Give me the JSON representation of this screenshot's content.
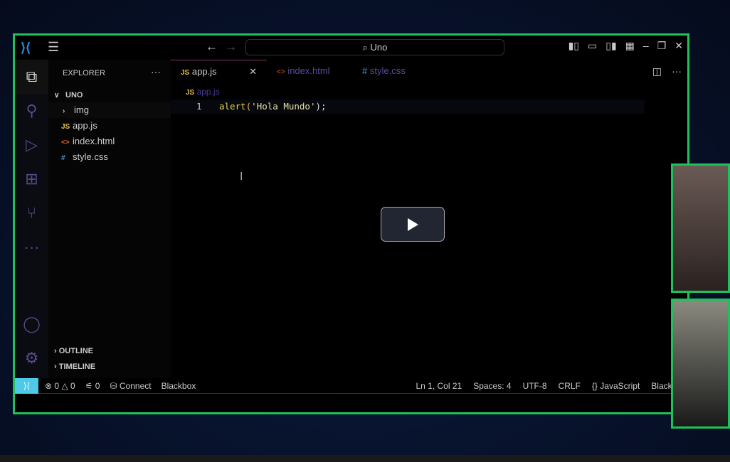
{
  "titlebar": {
    "search": "Uno",
    "back": "←",
    "forward": "→"
  },
  "sidebar": {
    "title": "EXPLORER",
    "folder": "UNO",
    "items": [
      {
        "icon": "chevron-right",
        "label": "img",
        "type": "folder"
      },
      {
        "icon": "JS",
        "label": "app.js",
        "type": "js"
      },
      {
        "icon": "<>",
        "label": "index.html",
        "type": "html"
      },
      {
        "icon": "#",
        "label": "style.css",
        "type": "css"
      }
    ],
    "outline": "OUTLINE",
    "timeline": "TIMELINE"
  },
  "tabs": [
    {
      "icon": "JS",
      "label": "app.js",
      "active": true
    },
    {
      "icon": "<>",
      "label": "index.html"
    },
    {
      "icon": "#",
      "label": "style.css"
    }
  ],
  "breadcrumb": {
    "icon": "JS",
    "label": "app.js"
  },
  "editor": {
    "line": "1",
    "code_fn": "alert",
    "code_paren_open": "(",
    "code_str": "'Hola Mundo'",
    "code_end": ");"
  },
  "status": {
    "errors": "0",
    "warnings": "0",
    "ports": "0",
    "connect": "Connect",
    "blackbox": "Blackbox",
    "position": "Ln 1, Col 21",
    "spaces": "Spaces: 4",
    "encoding": "UTF-8",
    "eol": "CRLF",
    "language": "JavaScript",
    "blackbox2": "Blackbox"
  },
  "colors": {
    "frame": "#1fc25a",
    "js": "#e8c14a",
    "html": "#e06030",
    "css": "#4a9ae0",
    "remote": "#4fc9e8"
  }
}
